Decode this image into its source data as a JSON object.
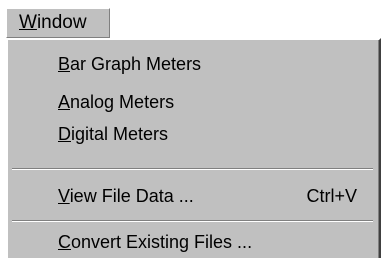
{
  "menubar": {
    "window_menu": {
      "label_first": "W",
      "label_rest": "indow"
    }
  },
  "menu": {
    "items": [
      {
        "mnemonic": "B",
        "rest": "ar Graph Meters",
        "shortcut": ""
      },
      {
        "mnemonic": "A",
        "rest": "nalog Meters",
        "shortcut": ""
      },
      {
        "mnemonic": "D",
        "rest": "igital Meters",
        "shortcut": ""
      },
      {
        "mnemonic": "V",
        "rest": "iew File Data ...",
        "shortcut": "Ctrl+V"
      },
      {
        "mnemonic": "C",
        "rest": "onvert Existing Files ...",
        "shortcut": ""
      }
    ]
  },
  "colors": {
    "menu_face": "#c0c0c0",
    "highlight": "#ffffff",
    "shadow": "#808080"
  }
}
